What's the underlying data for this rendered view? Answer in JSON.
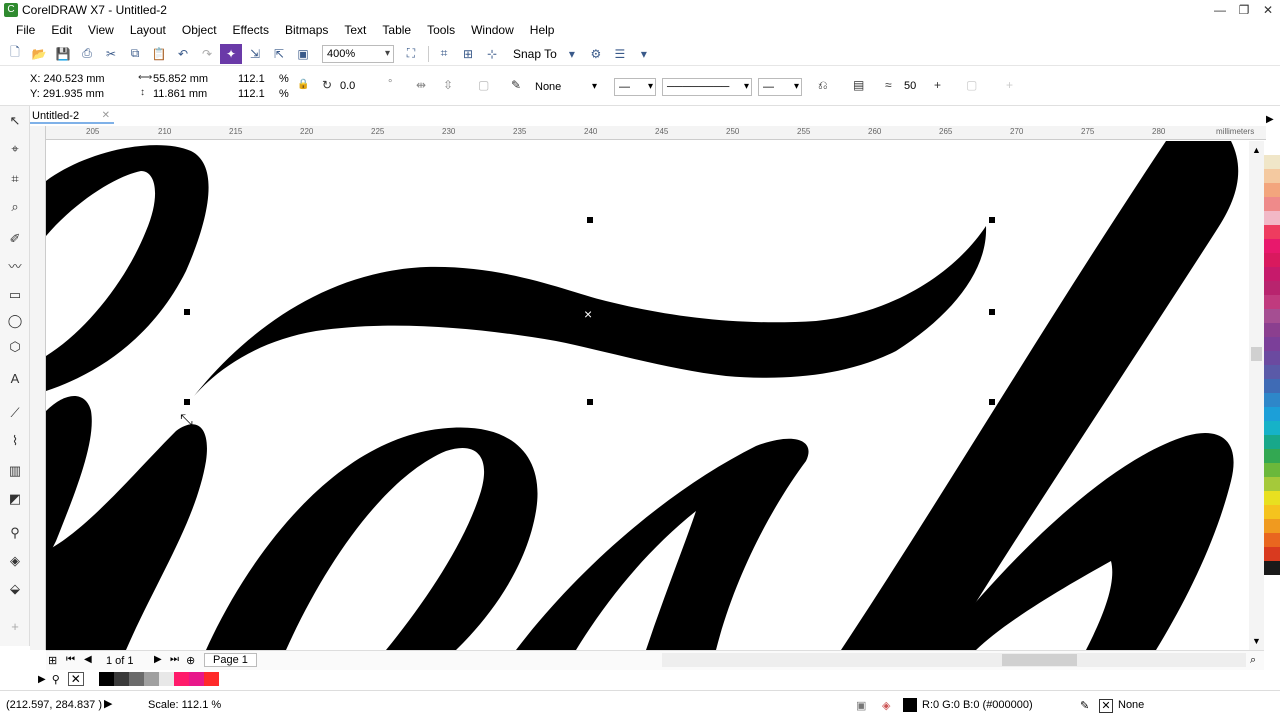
{
  "window": {
    "title": "CorelDRAW X7 - Untitled-2",
    "icon": "coreldraw-app-icon",
    "controls": [
      "minimize-icon",
      "restore-icon",
      "close-icon"
    ]
  },
  "menu": [
    "File",
    "Edit",
    "View",
    "Layout",
    "Object",
    "Effects",
    "Bitmaps",
    "Text",
    "Table",
    "Tools",
    "Window",
    "Help"
  ],
  "toolbar": {
    "zoom": "400%",
    "snap_to": "Snap To"
  },
  "property_bar": {
    "x": "X: 240.523 mm",
    "y": "Y: 291.935 mm",
    "width": "55.852 mm",
    "height": "11.861 mm",
    "scale_x": "112.1",
    "scale_y": "112.1",
    "pct_x": "%",
    "pct_y": "%",
    "rotation": "0.0",
    "rotation_unit": "°",
    "outline": "None",
    "smoothing": "50"
  },
  "doc_tab": {
    "label": "Untitled-2"
  },
  "ruler": {
    "h_ticks": [
      "205",
      "210",
      "215",
      "220",
      "225",
      "230",
      "235",
      "240",
      "245",
      "250",
      "255",
      "260",
      "265",
      "270",
      "275",
      "280"
    ],
    "unit": "millimeters"
  },
  "page_nav": {
    "counter": "1 of 1",
    "page_tab": "Page 1"
  },
  "palette_colors": [
    "#f0e6c8",
    "#f4c9a0",
    "#f3a57d",
    "#ef8a8a",
    "#f2b8c6",
    "#ee3c5f",
    "#e8186c",
    "#d9195e",
    "#c61a6b",
    "#b8246e",
    "#c03a7e",
    "#a54e92",
    "#8b3f8f",
    "#7b3f99",
    "#6b4aa0",
    "#5a5aa8",
    "#3f6bb5",
    "#2e87c9",
    "#1c9fd8",
    "#16b2c8",
    "#18a88a",
    "#33a852",
    "#6bb83b",
    "#a5c93a",
    "#e8e020",
    "#f5c31e",
    "#f09a1f",
    "#e9661f",
    "#d93a1f",
    "#1a1a1a"
  ],
  "doc_palette": [
    "#ffffff",
    "#000000",
    "#3a3a3a",
    "#6b6b6b",
    "#a0a0a0",
    "#e8e8e8",
    "#ff1b6b",
    "#e8188a",
    "#ff2a2a"
  ],
  "status": {
    "coords": "(212.597, 284.837 )",
    "scale": "Scale: 112.1 %",
    "fill": "R:0 G:0 B:0 (#000000)",
    "outline": "None"
  }
}
